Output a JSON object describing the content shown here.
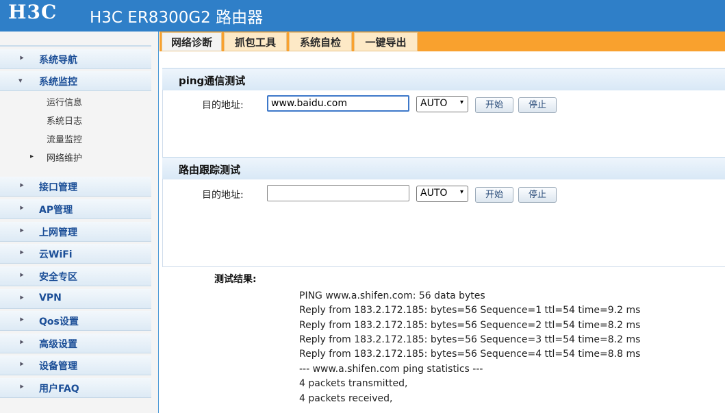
{
  "header": {
    "logo": "H3C",
    "title": "H3C ER8300G2 路由器"
  },
  "sidebar": {
    "items": [
      {
        "label": "系统导航"
      },
      {
        "label": "系统监控"
      },
      {
        "label": "接口管理"
      },
      {
        "label": "AP管理"
      },
      {
        "label": "上网管理"
      },
      {
        "label": "云WiFi"
      },
      {
        "label": "安全专区"
      },
      {
        "label": "VPN"
      },
      {
        "label": "Qos设置"
      },
      {
        "label": "高级设置"
      },
      {
        "label": "设备管理"
      },
      {
        "label": "用户FAQ"
      }
    ],
    "subitems": [
      {
        "label": "运行信息"
      },
      {
        "label": "系统日志"
      },
      {
        "label": "流量监控"
      },
      {
        "label": "网络维护"
      }
    ]
  },
  "tabs": [
    {
      "label": "网络诊断"
    },
    {
      "label": "抓包工具"
    },
    {
      "label": "系统自检"
    },
    {
      "label": "一键导出"
    }
  ],
  "ping": {
    "title": "ping通信测试",
    "dest_label": "目的地址:",
    "dest_value": "www.baidu.com",
    "mode": "AUTO",
    "start": "开始",
    "stop": "停止"
  },
  "trace": {
    "title": "路由跟踪测试",
    "dest_label": "目的地址:",
    "dest_value": "",
    "mode": "AUTO",
    "start": "开始",
    "stop": "停止"
  },
  "results": {
    "label": "测试结果:",
    "lines": [
      "PING www.a.shifen.com: 56 data bytes",
      "Reply from 183.2.172.185: bytes=56 Sequence=1 ttl=54 time=9.2 ms",
      "Reply from 183.2.172.185: bytes=56 Sequence=2 ttl=54 time=8.2 ms",
      "Reply from 183.2.172.185: bytes=56 Sequence=3 ttl=54 time=8.2 ms",
      "Reply from 183.2.172.185: bytes=56 Sequence=4 ttl=54 time=8.8 ms",
      "--- www.a.shifen.com ping statistics ---",
      "4 packets transmitted,",
      "4 packets received,"
    ]
  }
}
